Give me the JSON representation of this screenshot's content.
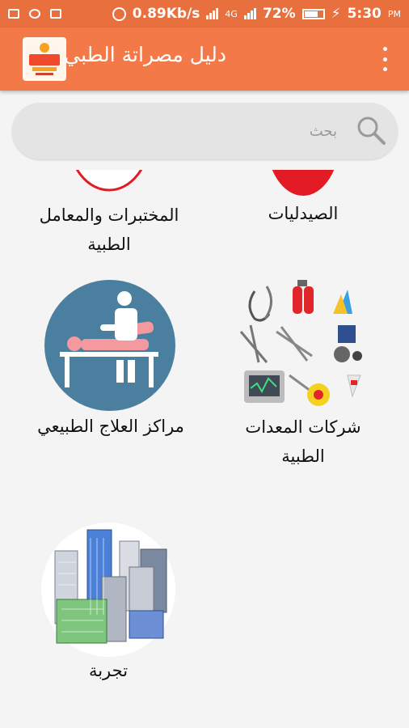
{
  "status_bar": {
    "net_speed": "0.89Kb/s",
    "net_type": "4G",
    "battery_percent": "72%",
    "time": "5:30",
    "ampm": "PM"
  },
  "app_bar": {
    "title": "دليل مصراتة الطبي"
  },
  "search": {
    "placeholder": "بحث"
  },
  "categories": [
    {
      "label": "الصيدليات",
      "icon": "pharmacy-icon"
    },
    {
      "label": "المختبرات والمعامل الطبية",
      "icon": "laboratory-icon"
    },
    {
      "label": "شركات المعدات الطبية",
      "icon": "medical-equipment-icon"
    },
    {
      "label": "مراكز العلاج الطبيعي",
      "icon": "physiotherapy-icon"
    },
    {
      "label": "تجربة",
      "icon": "buildings-icon"
    }
  ],
  "colors": {
    "status_bar": "#e8703f",
    "app_bar": "#f37a48",
    "physio_circle": "#4a7fa0"
  }
}
